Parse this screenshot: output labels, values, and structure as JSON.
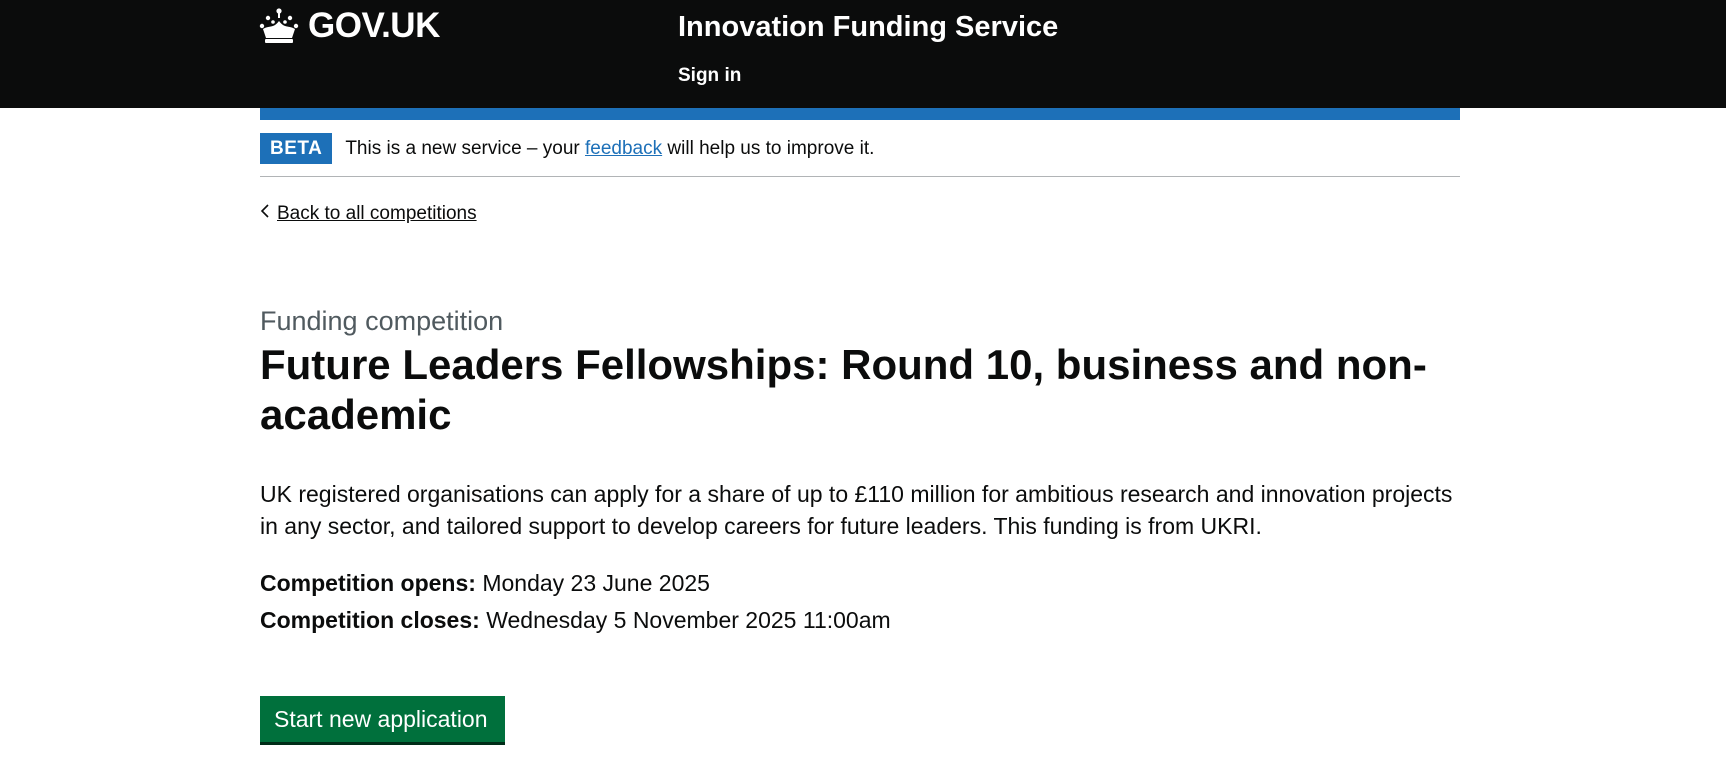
{
  "header": {
    "logo_text": "GOV.UK",
    "logo_icon": "crown-icon",
    "service_name": "Innovation Funding Service",
    "sign_in": "Sign in"
  },
  "beta_banner": {
    "tag": "BETA",
    "text_before": "This is a new service – your ",
    "link": "feedback",
    "text_after": " will help us to improve it."
  },
  "back_link": {
    "icon": "chevron-left-icon",
    "label": "Back to all competitions"
  },
  "main": {
    "caption": "Funding competition",
    "title": "Future Leaders Fellowships: Round 10, business and non-academic",
    "summary": "UK registered organisations can apply for a share of up to £110 million for ambitious research and innovation projects in any sector, and tailored support to develop careers for future leaders. This funding is from UKRI.",
    "opens_label": "Competition opens:",
    "opens_value": " Monday 23 June 2025",
    "closes_label": "Competition closes:",
    "closes_value": " Wednesday 5 November 2025 11:00am",
    "start_button": "Start new application"
  },
  "colors": {
    "header_bg": "#0b0c0c",
    "brand_blue": "#1d70b8",
    "button_green": "#00703c",
    "caption_grey": "#505a5f"
  }
}
